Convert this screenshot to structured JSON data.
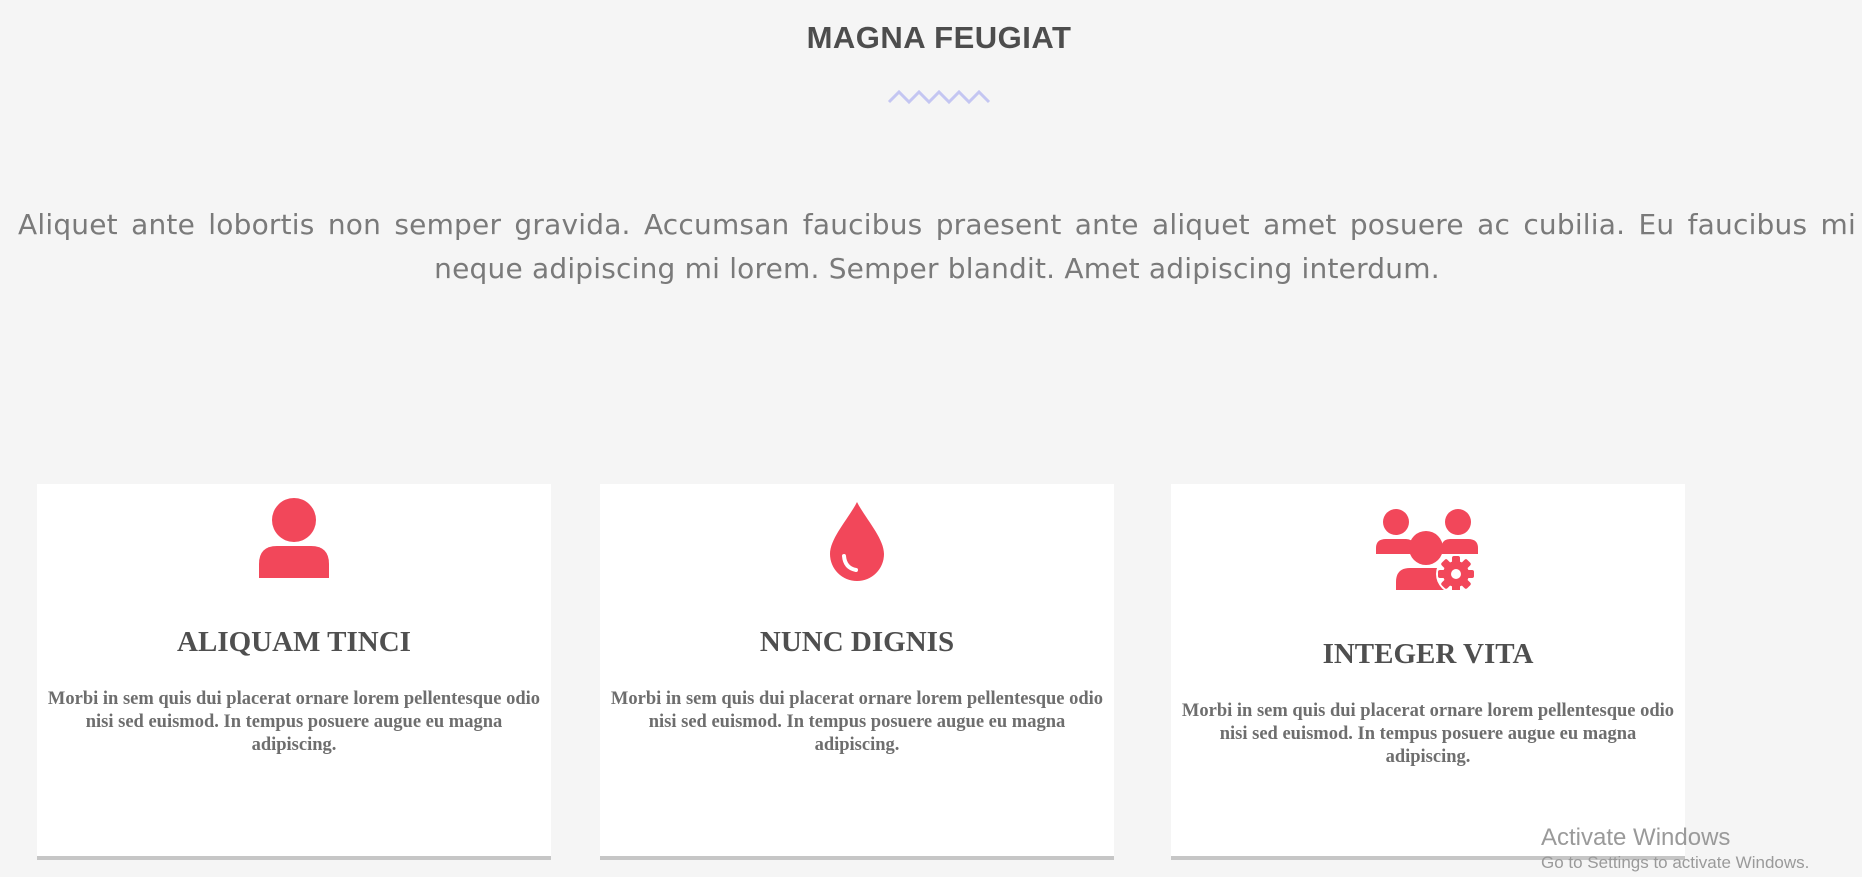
{
  "section": {
    "title": "MAGNA FEUGIAT",
    "intro": "Aliquet ante lobortis non semper gravida. Accumsan faucibus praesent ante aliquet amet posuere ac cubilia. Eu faucibus mi neque adipiscing mi lorem. Semper blandit. Amet adipiscing interdum."
  },
  "colors": {
    "accent": "#f2475a",
    "zigzag": "#c4c6f2",
    "background": "#f5f5f5"
  },
  "cards": [
    {
      "icon": "user-icon",
      "title": "ALIQUAM TINCI",
      "text": "Morbi in sem quis dui placerat ornare lorem pellentesque odio nisi sed euismod. In tempus posuere augue eu magna adipiscing."
    },
    {
      "icon": "droplet-icon",
      "title": "NUNC DIGNIS",
      "text": "Morbi in sem quis dui placerat ornare lorem pellentesque odio nisi sed euismod. In tempus posuere augue eu magna adipiscing."
    },
    {
      "icon": "users-cog-icon",
      "title": "INTEGER VITA",
      "text": "Morbi in sem quis dui placerat ornare lorem pellentesque odio nisi sed euismod. In tempus posuere augue eu magna adipiscing."
    }
  ],
  "watermark": {
    "title": "Activate Windows",
    "subtitle": "Go to Settings to activate Windows."
  }
}
